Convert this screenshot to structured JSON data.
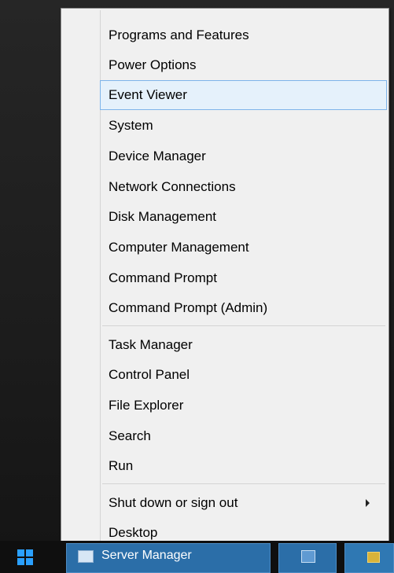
{
  "menu": {
    "group1": [
      {
        "label": "Programs and Features"
      },
      {
        "label": "Power Options"
      },
      {
        "label": "Event Viewer",
        "highlighted": true
      },
      {
        "label": "System"
      },
      {
        "label": "Device Manager"
      },
      {
        "label": "Network Connections"
      },
      {
        "label": "Disk Management"
      },
      {
        "label": "Computer Management"
      },
      {
        "label": "Command Prompt"
      },
      {
        "label": "Command Prompt (Admin)"
      }
    ],
    "group2": [
      {
        "label": "Task Manager"
      },
      {
        "label": "Control Panel"
      },
      {
        "label": "File Explorer"
      },
      {
        "label": "Search"
      },
      {
        "label": "Run"
      }
    ],
    "group3": [
      {
        "label": "Shut down or sign out",
        "has_submenu": true
      },
      {
        "label": "Desktop"
      }
    ]
  },
  "taskbar": {
    "server_manager_label": "Server Manager",
    "start_icon": "windows-logo-icon",
    "server_manager_icon": "server-manager-icon",
    "powershell_icon": "powershell-icon",
    "explorer_icon": "file-explorer-icon"
  },
  "colors": {
    "highlight_bg": "#e5f1fb",
    "highlight_border": "#7eb4ea",
    "menu_bg": "#f0f0f0",
    "taskbar_accent": "#2b6ea8",
    "start_logo": "#2aa0ff"
  }
}
